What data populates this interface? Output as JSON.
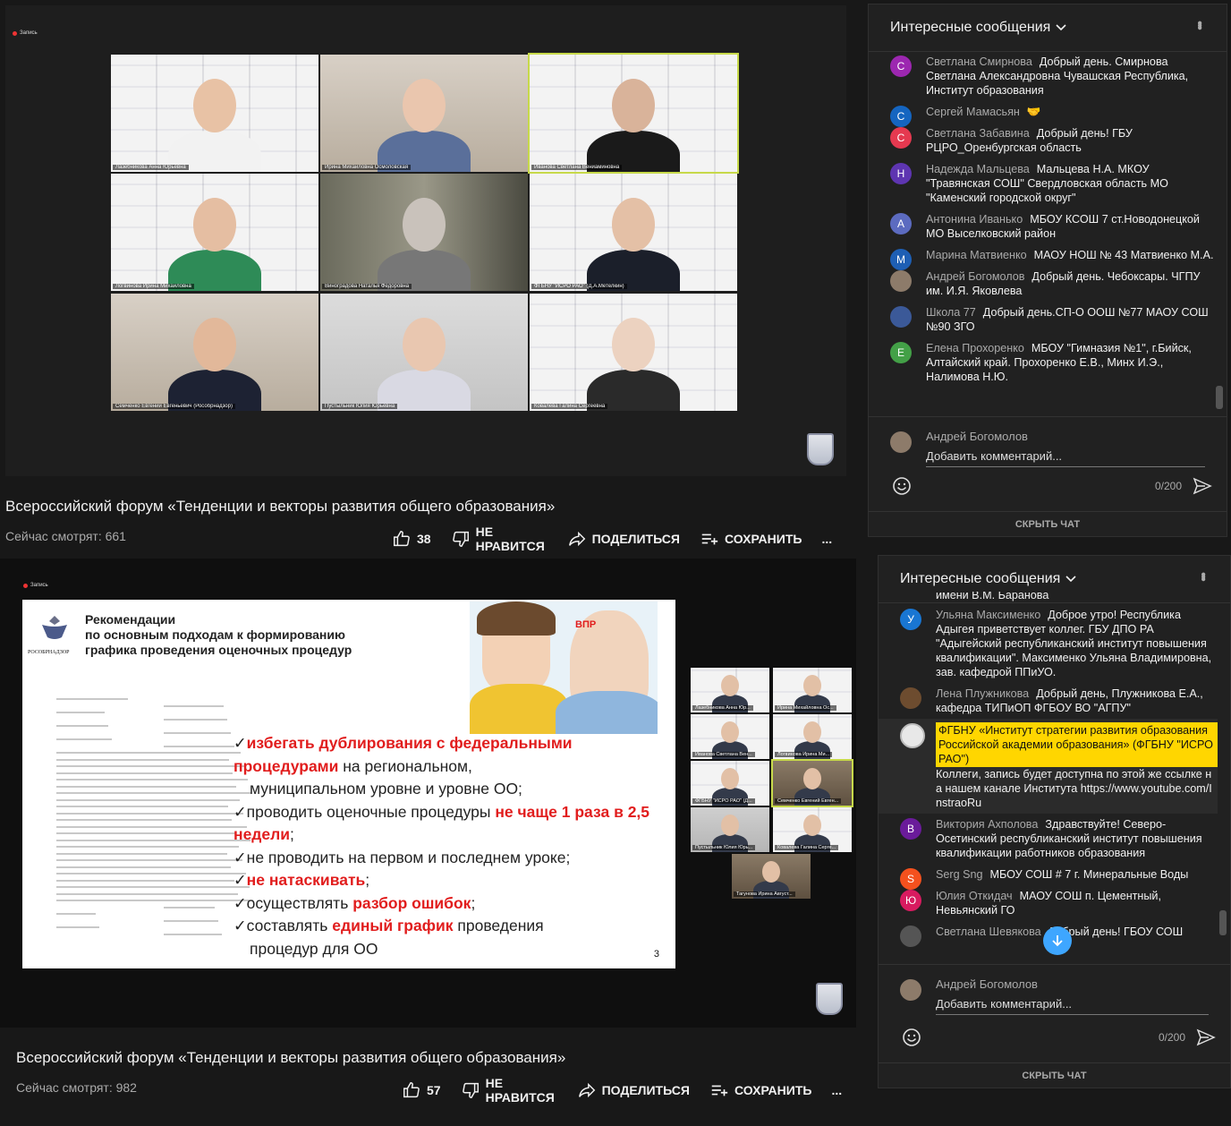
{
  "stream1": {
    "rec_label": "Запись",
    "title": "Всероссийский форум «Тенденции и векторы развития общего образования»",
    "viewers": "Сейчас смотрят: 661",
    "likes": "38",
    "dislike_label": "НЕ НРАВИТСЯ",
    "share_label": "ПОДЕЛИТЬСЯ",
    "save_label": "СОХРАНИТЬ",
    "more": "...",
    "participants": [
      "Лазебникова Анна Юрьевна",
      "Ирина Михайловна Осмоловская",
      "Иванова Светлана Вениаминовна",
      "Логвинова Ирина Михайловна",
      "Виноградова Наталья Федоровна",
      "ФГБНУ \"ИСРО РАО\" (Д.А.Метелкин)",
      "Семченко Евгений Евгеньевич (Рособрнадзор)",
      "Пустыльник Юлия Юрьевна",
      "Ковалева Галина Сергеевна"
    ]
  },
  "stream2": {
    "rec_label": "Запись",
    "title": "Всероссийский форум «Тенденции и векторы развития общего образования»",
    "viewers": "Сейчас смотрят: 982",
    "likes": "57",
    "dislike_label": "НЕ НРАВИТСЯ",
    "share_label": "ПОДЕЛИТЬСЯ",
    "save_label": "СОХРАНИТЬ",
    "more": "...",
    "participants": [
      "Лазебникова Анна Юр...",
      "Ирина Михайловна Ос...",
      "Иванова Светлана Вен...",
      "Логвинова Ирина Ми...",
      "ФГБНУ \"ИСРО РАО\" (Д...",
      "Семченко Евгений Евген...",
      "Пустыльник Юлия Юрь...",
      "Ковалева Галина Серге...",
      "Тагунова Ирина Август..."
    ],
    "slide": {
      "org": "РОСОБРНАДЗОР",
      "heading1": "Рекомендации",
      "heading2": "по основным подходам к формированию",
      "heading3": "графика проведения оценочных процедур",
      "vpr": "ВПР",
      "page_number": "3",
      "b1_red": "избегать дублирования с федеральными процедурами",
      "b1_rest": " на региональном,",
      "b1_line3": "муниципальном уровне и уровне ОО;",
      "b2_a": "проводить оценочные процедуры ",
      "b2_red": "не чаще 1 раза в 2,5 недели",
      "b2_end": ";",
      "b3": "не проводить на первом и последнем уроке;",
      "b4_red": "не натаскивать",
      "b4_end": ";",
      "b5_a": "осуществлять ",
      "b5_red": "разбор ошибок",
      "b5_end": ";",
      "b6_a": "составлять ",
      "b6_red": "единый график",
      "b6_rest": " проведения",
      "b6_line2": "процедур для ОО"
    }
  },
  "chat1": {
    "title": "Интересные сообщения",
    "messages": [
      {
        "initial": "С",
        "color": "#9c27b0",
        "author": "Светлана Смирнова",
        "text": "Добрый день. Смирнова Светлана Александровна Чувашская Республика, Институт образования"
      },
      {
        "initial": "С",
        "color": "#1565c0",
        "author": "Сергей Мамасьян",
        "text": "🤝"
      },
      {
        "initial": "С",
        "color": "#e53950",
        "author": "Светлана Забавина",
        "text": "Добрый день! ГБУ РЦРО_Оренбургская область"
      },
      {
        "initial": "Н",
        "color": "#5e35b1",
        "author": "Надежда Мальцева",
        "text": "Мальцева Н.А. МКОУ \"Травянская СОШ\" Свердловская область МО \"Каменский городской округ\""
      },
      {
        "initial": "А",
        "color": "#5c6bc0",
        "author": "Антонина Иванько",
        "text": "МБОУ КСОШ 7 ст.Новодонецкой МО Выселковский район"
      },
      {
        "initial": "М",
        "color": "#1e5fb4",
        "author": "Марина Матвиенко",
        "text": "МАОУ НОШ № 43 Матвиенко М.А."
      },
      {
        "initial": "",
        "color": "#8d7b6a",
        "author": "Андрей Богомолов",
        "text": "Добрый день. Чебоксары. ЧГПУ им. И.Я. Яковлева"
      },
      {
        "initial": "",
        "color": "#3b5998",
        "author": "Школа 77",
        "text": "Добрый день.СП-О ООШ №77 МАОУ СОШ №90 ЗГО"
      },
      {
        "initial": "Е",
        "color": "#43a047",
        "author": "Елена Прохоренко",
        "text": "МБОУ \"Гимназия №1\", г.Бийск, Алтайский край. Прохоренко Е.В., Минх И.Э., Налимова Н.Ю."
      }
    ],
    "compose_user": "Андрей Богомолов",
    "compose_placeholder": "Добавить комментарий...",
    "counter": "0/200",
    "hide_label": "СКРЫТЬ ЧАТ"
  },
  "chat2": {
    "title": "Интересные сообщения",
    "cut_top": "имени В.М. Баранова",
    "messages": [
      {
        "initial": "У",
        "color": "#1976d2",
        "author": "Ульяна Максименко",
        "text": "Доброе утро! Республика Адыгея приветствует коллег. ГБУ ДПО РА \"Адыгейский республиканский институт повышения квалификации\". Максименко Ульяна Владимировна, зав. кафедрой ППиУО."
      },
      {
        "initial": "",
        "color": "#6d4c2f",
        "author": "Лена Плужникова",
        "text": "Добрый день, Плужникова Е.А., кафедра ТИПиОП ФГБОУ ВО \"АГПУ\""
      },
      {
        "initial": "",
        "color": "#e8e8e8",
        "author": "ФГБНУ «Институт стратегии развития образования Российской академии образования» (ФГБНУ \"ИСРО РАО\")",
        "text": "Коллеги, запись будет доступна по этой же ссылке на нашем канале Института https://www.youtube.com/InstraoRu",
        "highlight": true
      },
      {
        "initial": "В",
        "color": "#6a1b9a",
        "author": "Виктория Ахполова",
        "text": "Здравствуйте! Северо-Осетинский республиканский институт повышения квалификации работников образования"
      },
      {
        "initial": "S",
        "color": "#f4511e",
        "author": "Serg Sng",
        "text": "МБОУ СОШ # 7 г. Минеральные Воды"
      },
      {
        "initial": "Ю",
        "color": "#d81b60",
        "author": "Юлия Откидач",
        "text": "МАОУ СОШ п. Цементный, Невьянский ГО"
      },
      {
        "initial": "",
        "color": "#555",
        "author": "Светлана Шевякова",
        "text": "Добрый день! ГБОУ СОШ"
      }
    ],
    "compose_user": "Андрей Богомолов",
    "compose_placeholder": "Добавить комментарий...",
    "counter": "0/200",
    "hide_label": "СКРЫТЬ ЧАТ"
  }
}
